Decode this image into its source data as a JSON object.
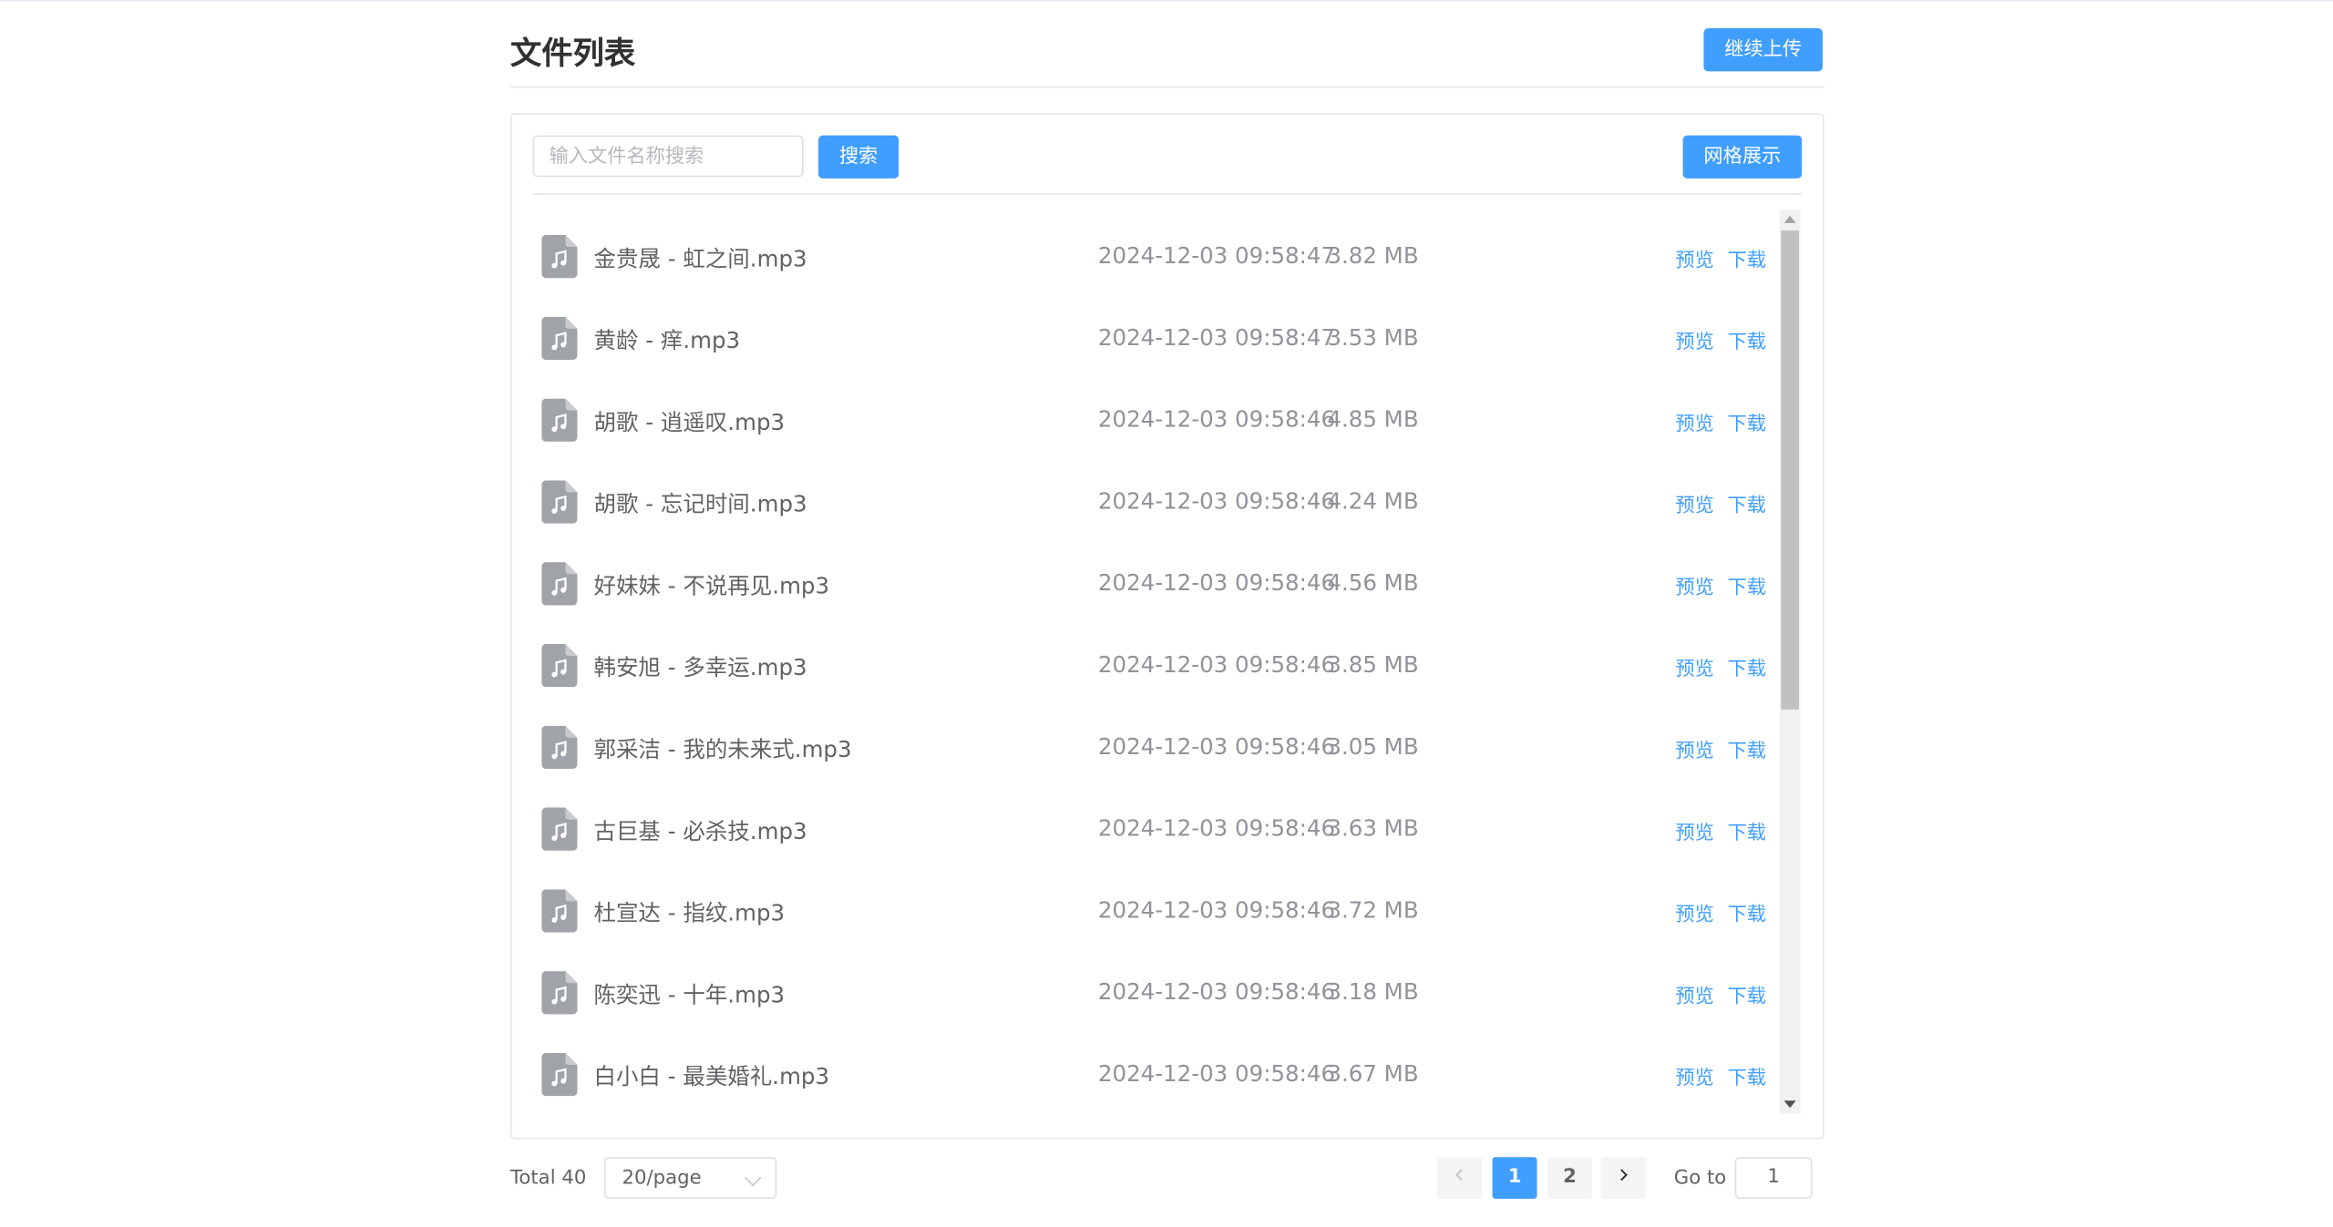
{
  "header": {
    "title": "文件列表",
    "upload_label": "继续上传"
  },
  "toolbar": {
    "search_placeholder": "输入文件名称搜索",
    "search_label": "搜索",
    "grid_label": "网格展示"
  },
  "files": [
    {
      "name": "金贵晟 - 虹之间.mp3",
      "time": "2024-12-03 09:58:47",
      "size": "3.82 MB",
      "preview": "预览",
      "download": "下载"
    },
    {
      "name": "黄龄 - 痒.mp3",
      "time": "2024-12-03 09:58:47",
      "size": "3.53 MB",
      "preview": "预览",
      "download": "下载"
    },
    {
      "name": "胡歌 - 逍遥叹.mp3",
      "time": "2024-12-03 09:58:46",
      "size": "4.85 MB",
      "preview": "预览",
      "download": "下载"
    },
    {
      "name": "胡歌 - 忘记时间.mp3",
      "time": "2024-12-03 09:58:46",
      "size": "4.24 MB",
      "preview": "预览",
      "download": "下载"
    },
    {
      "name": "好妹妹 - 不说再见.mp3",
      "time": "2024-12-03 09:58:46",
      "size": "4.56 MB",
      "preview": "预览",
      "download": "下载"
    },
    {
      "name": "韩安旭 - 多幸运.mp3",
      "time": "2024-12-03 09:58:46",
      "size": "3.85 MB",
      "preview": "预览",
      "download": "下载"
    },
    {
      "name": "郭采洁 - 我的未来式.mp3",
      "time": "2024-12-03 09:58:46",
      "size": "3.05 MB",
      "preview": "预览",
      "download": "下载"
    },
    {
      "name": "古巨基 - 必杀技.mp3",
      "time": "2024-12-03 09:58:46",
      "size": "3.63 MB",
      "preview": "预览",
      "download": "下载"
    },
    {
      "name": "杜宣达 - 指纹.mp3",
      "time": "2024-12-03 09:58:46",
      "size": "3.72 MB",
      "preview": "预览",
      "download": "下载"
    },
    {
      "name": "陈奕迅 - 十年.mp3",
      "time": "2024-12-03 09:58:46",
      "size": "3.18 MB",
      "preview": "预览",
      "download": "下载"
    },
    {
      "name": "白小白 - 最美婚礼.mp3",
      "time": "2024-12-03 09:58:46",
      "size": "3.67 MB",
      "preview": "预览",
      "download": "下载"
    }
  ],
  "pagination": {
    "total_label": "Total 40",
    "page_size": "20/page",
    "pages": [
      "1",
      "2"
    ],
    "current_page": "1",
    "goto_label": "Go to",
    "goto_value": "1"
  },
  "colors": {
    "primary": "#409eff",
    "icon_gray": "#a0a3a8"
  },
  "icons": {
    "file": "music-file-icon",
    "prev": "chevron-left-icon",
    "next": "chevron-right-icon",
    "select": "chevron-down-icon"
  }
}
